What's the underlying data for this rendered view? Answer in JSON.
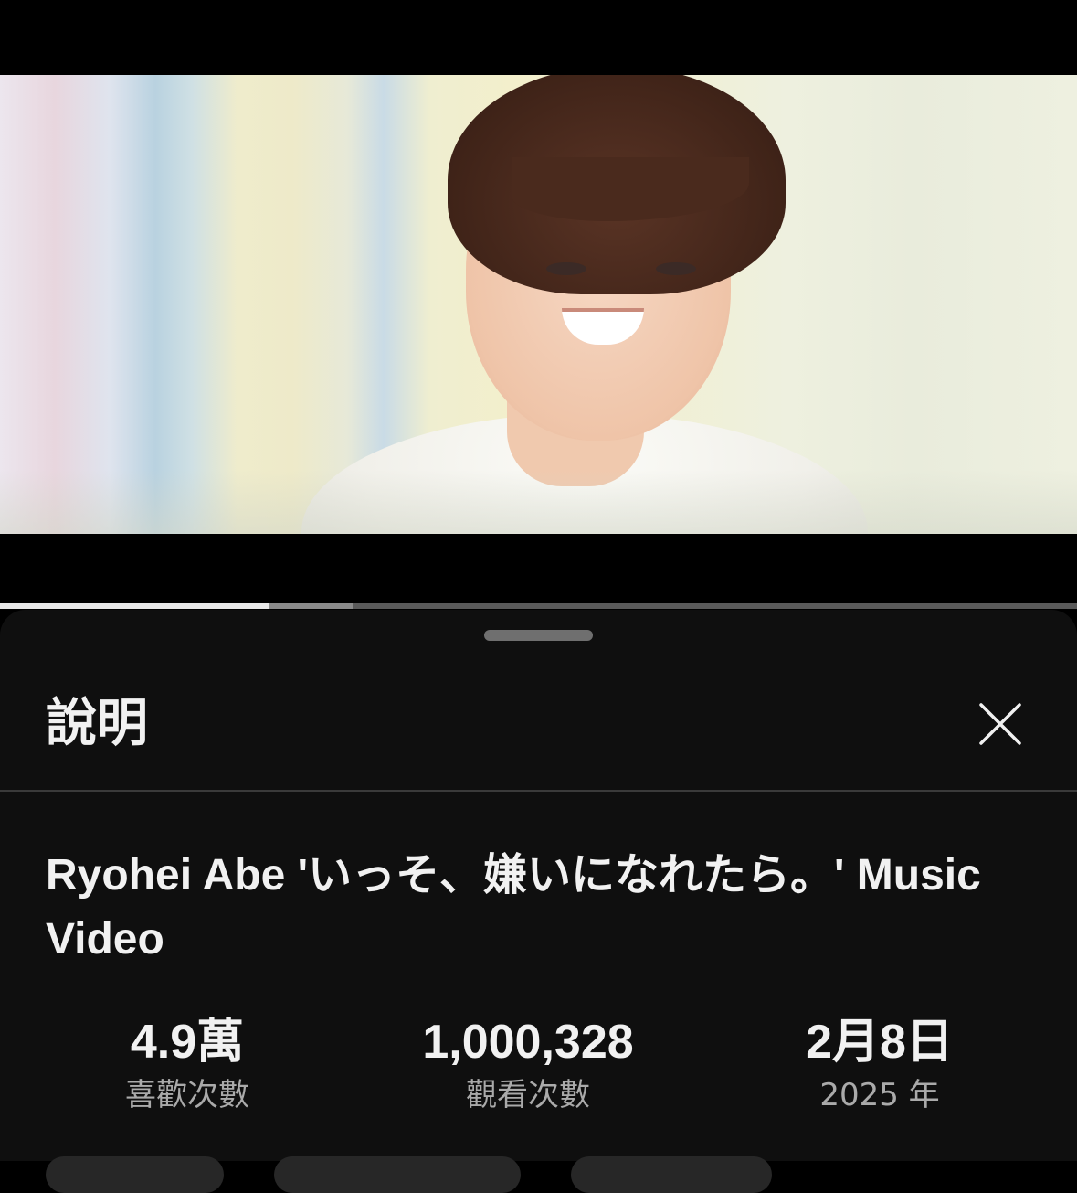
{
  "player": {
    "progress_played": 0.25,
    "progress_buffered": 0.327
  },
  "sheet": {
    "title": "說明",
    "close_icon": "close-icon"
  },
  "video": {
    "title": "Ryohei Abe 'いっそ、嫌いになれたら。' Music Video"
  },
  "stats": [
    {
      "value": "4.9萬",
      "label": "喜歡次數"
    },
    {
      "value": "1,000,328",
      "label": "觀看次數"
    },
    {
      "value": "2月8日",
      "label": "2025 年"
    }
  ],
  "colors": {
    "sheet_background": "#0f0f0f",
    "primary_text": "#f1f1f1",
    "secondary_text": "#aaaaaa"
  }
}
